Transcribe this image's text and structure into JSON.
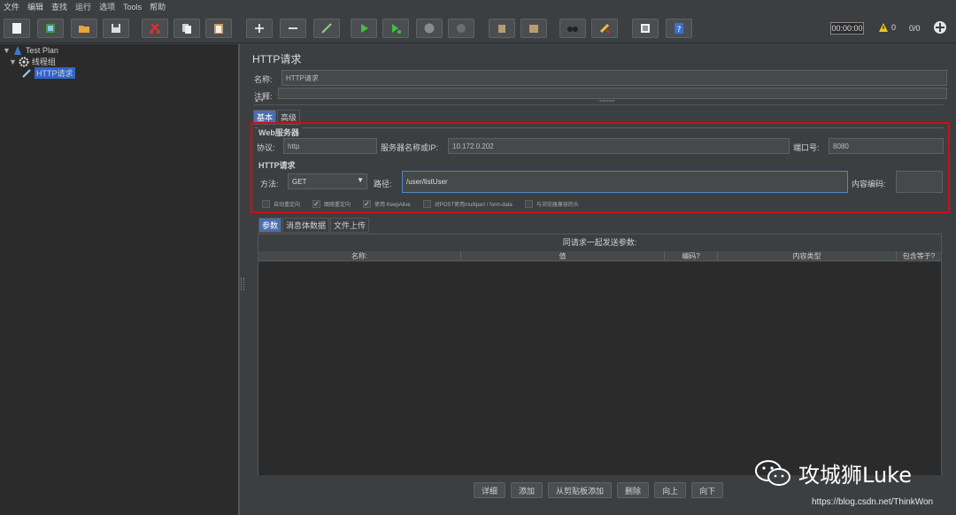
{
  "menu": [
    "文件",
    "编辑",
    "查找",
    "运行",
    "选项",
    "Tools",
    "帮助"
  ],
  "toolbar": {
    "timer": "00:00:00",
    "warnings": "0",
    "ratio": "0/0"
  },
  "tree": {
    "root": "Test Plan",
    "group": "线程组",
    "sampler": "HTTP请求"
  },
  "panel": {
    "title": "HTTP请求",
    "name_label": "名称:",
    "name_value": "HTTP请求",
    "comment_label": "注释:",
    "tabs": [
      "基本",
      "高级"
    ],
    "web_server_title": "Web服务器",
    "protocol_label": "协议:",
    "protocol_value": "http",
    "server_label": "服务器名称或IP:",
    "server_value": "10.172.0.202",
    "port_label": "端口号:",
    "port_value": "8080",
    "http_request_title": "HTTP请求",
    "method_label": "方法:",
    "method_value": "GET",
    "path_label": "路径:",
    "path_value": "/user/listUser",
    "encoding_label": "内容编码:",
    "checkboxes": [
      {
        "label": "自动重定向",
        "checked": false
      },
      {
        "label": "跟随重定向",
        "checked": true
      },
      {
        "label": "使用 KeepAlive",
        "checked": true
      },
      {
        "label": "对POST使用multipart / form-data",
        "checked": false
      },
      {
        "label": "与浏览器兼容的头",
        "checked": false
      }
    ],
    "sub_tabs": [
      "参数",
      "消息体数据",
      "文件上传"
    ],
    "table_caption": "同请求一起发送参数:",
    "columns": [
      "名称:",
      "值",
      "编码?",
      "内容类型",
      "包含等于?"
    ],
    "buttons": [
      "详细",
      "添加",
      "从剪贴板添加",
      "删除",
      "向上",
      "向下"
    ]
  },
  "watermark": {
    "brand": "攻城狮Luke",
    "url": "https://blog.csdn.net/ThinkWon"
  },
  "colors": {
    "highlight_box": "#d00d18",
    "selection": "#2f65ca",
    "active_tab": "#4b6eaf"
  }
}
